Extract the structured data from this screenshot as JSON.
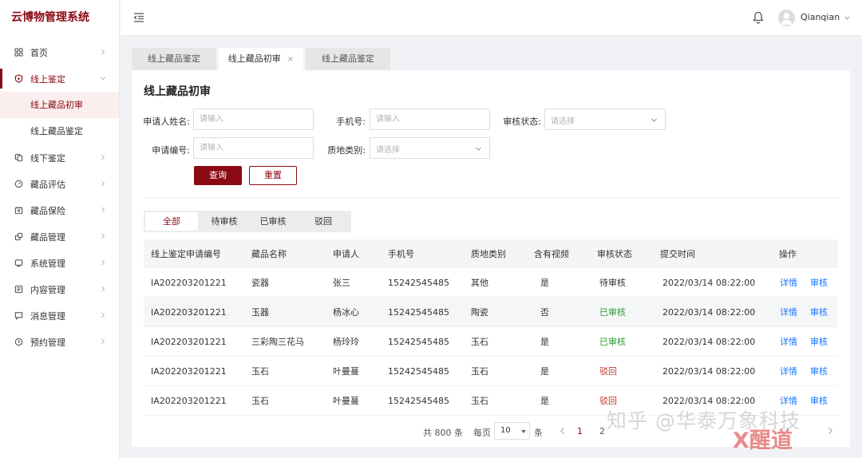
{
  "app": {
    "title": "云博物管理系统"
  },
  "sidebar": {
    "items": [
      {
        "label": "首页",
        "icon": "grid-icon"
      },
      {
        "label": "线上鉴定",
        "icon": "shield-icon",
        "children": [
          "线上藏品初审",
          "线上藏品鉴定"
        ]
      },
      {
        "label": "线下鉴定",
        "icon": "copy-icon"
      },
      {
        "label": "藏品评估",
        "icon": "gauge-icon"
      },
      {
        "label": "藏品保险",
        "icon": "insurance-icon"
      },
      {
        "label": "藏品管理",
        "icon": "box-icon"
      },
      {
        "label": "系统管理",
        "icon": "system-icon"
      },
      {
        "label": "内容管理",
        "icon": "content-icon"
      },
      {
        "label": "消息管理",
        "icon": "message-icon"
      },
      {
        "label": "预约管理",
        "icon": "clock-icon"
      }
    ]
  },
  "header": {
    "username": "Qianqian"
  },
  "tabs": [
    {
      "label": "线上藏品鉴定"
    },
    {
      "label": "线上藏品初审",
      "close": "×"
    },
    {
      "label": "线上藏品鉴定"
    }
  ],
  "page": {
    "title": "线上藏品初审"
  },
  "filters": {
    "applicant_name_label": "申请人姓名:",
    "applicant_name_placeholder": "请输入",
    "phone_label": "手机号:",
    "phone_placeholder": "请输入",
    "status_label": "审核状态:",
    "status_placeholder": "请选择",
    "app_no_label": "申请编号:",
    "app_no_placeholder": "请输入",
    "material_label": "质地类别:",
    "material_placeholder": "请选择",
    "query_label": "查询",
    "reset_label": "重置"
  },
  "status_tabs": [
    "全部",
    "待审核",
    "已审核",
    "驳回"
  ],
  "table": {
    "headers": [
      "线上鉴定申请编号",
      "藏品名称",
      "申请人",
      "手机号",
      "质地类别",
      "含有视频",
      "审核状态",
      "提交时间",
      "操作"
    ],
    "rows": [
      {
        "id": "IA202203201221",
        "name": "瓷器",
        "applicant": "张三",
        "phone": "15242545485",
        "material": "其他",
        "video": "是",
        "status": "待审核",
        "status_type": "pending",
        "time": "2022/03/14 08:22:00"
      },
      {
        "id": "IA202203201221",
        "name": "玉器",
        "applicant": "杨冰心",
        "phone": "15242545485",
        "material": "陶瓷",
        "video": "否",
        "status": "已审核",
        "status_type": "approved",
        "time": "2022/03/14 08:22:00"
      },
      {
        "id": "IA202203201221",
        "name": "三彩陶三花马",
        "applicant": "杨玲玲",
        "phone": "15242545485",
        "material": "玉石",
        "video": "是",
        "status": "已审核",
        "status_type": "approved",
        "time": "2022/03/14 08:22:00"
      },
      {
        "id": "IA202203201221",
        "name": "玉石",
        "applicant": "叶曼蔓",
        "phone": "15242545485",
        "material": "玉石",
        "video": "是",
        "status": "驳回",
        "status_type": "rejected",
        "time": "2022/03/14 08:22:00"
      },
      {
        "id": "IA202203201221",
        "name": "玉石",
        "applicant": "叶曼蔓",
        "phone": "15242545485",
        "material": "玉石",
        "video": "是",
        "status": "驳回",
        "status_type": "rejected",
        "time": "2022/03/14 08:22:00"
      }
    ],
    "actions": [
      "详情",
      "审核"
    ]
  },
  "pagination": {
    "total_label": "共 800 条",
    "per_page_label": "每页",
    "page_size": "10",
    "unit_label": "条",
    "pages": [
      "1",
      "2"
    ],
    "current": "1"
  },
  "watermark": {
    "text": "知乎 @华泰万象科技",
    "logo_text": "X醒道"
  },
  "colors": {
    "brand": "#8b0a14",
    "link": "#1677ff",
    "approved": "#2e9c2e",
    "rejected": "#c0392b"
  }
}
